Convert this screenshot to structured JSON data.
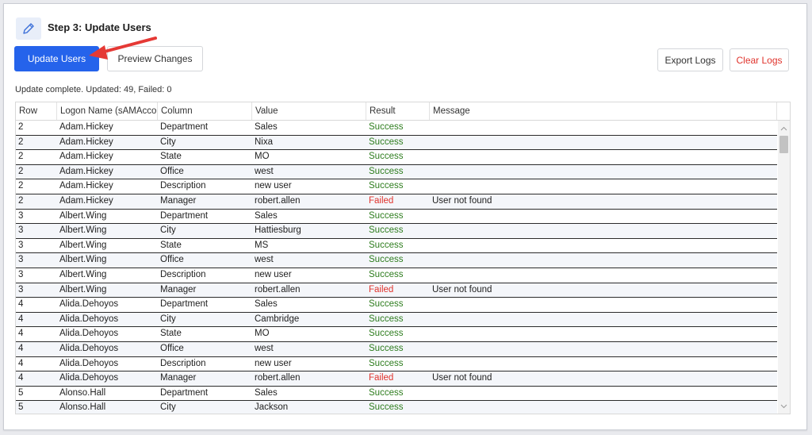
{
  "step": {
    "title": "Step 3: Update Users"
  },
  "toolbar": {
    "update_label": "Update Users",
    "preview_label": "Preview Changes",
    "export_label": "Export Logs",
    "clear_label": "Clear Logs"
  },
  "status": "Update complete. Updated: 49, Failed: 0",
  "colors": {
    "primary": "#2563eb",
    "success": "#2e7d1e",
    "failed": "#e0332c",
    "arrow": "#e53935"
  },
  "grid": {
    "headers": [
      "Row",
      "Logon Name (sAMAccountName)",
      "Column",
      "Value",
      "Result",
      "Message"
    ],
    "rows": [
      [
        "2",
        "Adam.Hickey",
        "Department",
        "Sales",
        "Success",
        ""
      ],
      [
        "2",
        "Adam.Hickey",
        "City",
        "Nixa",
        "Success",
        ""
      ],
      [
        "2",
        "Adam.Hickey",
        "State",
        "MO",
        "Success",
        ""
      ],
      [
        "2",
        "Adam.Hickey",
        "Office",
        "west",
        "Success",
        ""
      ],
      [
        "2",
        "Adam.Hickey",
        "Description",
        "new user",
        "Success",
        ""
      ],
      [
        "2",
        "Adam.Hickey",
        "Manager",
        "robert.allen",
        "Failed",
        "User not found"
      ],
      [
        "3",
        "Albert.Wing",
        "Department",
        "Sales",
        "Success",
        ""
      ],
      [
        "3",
        "Albert.Wing",
        "City",
        "Hattiesburg",
        "Success",
        ""
      ],
      [
        "3",
        "Albert.Wing",
        "State",
        "MS",
        "Success",
        ""
      ],
      [
        "3",
        "Albert.Wing",
        "Office",
        "west",
        "Success",
        ""
      ],
      [
        "3",
        "Albert.Wing",
        "Description",
        "new user",
        "Success",
        ""
      ],
      [
        "3",
        "Albert.Wing",
        "Manager",
        "robert.allen",
        "Failed",
        "User not found"
      ],
      [
        "4",
        "Alida.Dehoyos",
        "Department",
        "Sales",
        "Success",
        ""
      ],
      [
        "4",
        "Alida.Dehoyos",
        "City",
        "Cambridge",
        "Success",
        ""
      ],
      [
        "4",
        "Alida.Dehoyos",
        "State",
        "MO",
        "Success",
        ""
      ],
      [
        "4",
        "Alida.Dehoyos",
        "Office",
        "west",
        "Success",
        ""
      ],
      [
        "4",
        "Alida.Dehoyos",
        "Description",
        "new user",
        "Success",
        ""
      ],
      [
        "4",
        "Alida.Dehoyos",
        "Manager",
        "robert.allen",
        "Failed",
        "User not found"
      ],
      [
        "5",
        "Alonso.Hall",
        "Department",
        "Sales",
        "Success",
        ""
      ],
      [
        "5",
        "Alonso.Hall",
        "City",
        "Jackson",
        "Success",
        ""
      ]
    ]
  }
}
